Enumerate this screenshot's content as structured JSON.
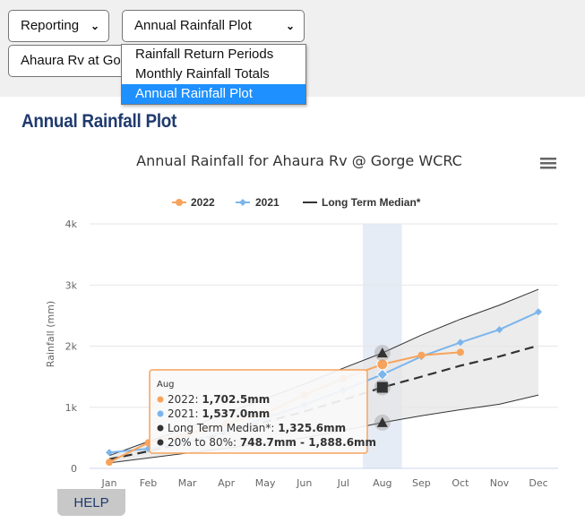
{
  "controls": {
    "report_select": {
      "value": "Reporting",
      "chevron_icon": "chevron-down-icon"
    },
    "plot_select": {
      "value": "Annual Rainfall Plot",
      "chevron_icon": "chevron-down-icon"
    },
    "site_select": {
      "value": "Ahaura Rv at Gorge"
    },
    "plot_options": [
      {
        "label": "Rainfall Return Periods",
        "selected": false
      },
      {
        "label": "Monthly Rainfall Totals",
        "selected": false
      },
      {
        "label": "Annual Rainfall Plot",
        "selected": true
      }
    ]
  },
  "page": {
    "title": "Annual Rainfall Plot",
    "help_label": "HELP",
    "menu_icon": "hamburger-menu-icon"
  },
  "colors": {
    "s2022": "#f7a35c",
    "s2021": "#7cb5ec",
    "median": "#333333",
    "band": "#e6e6e6",
    "title": "#1f3a6e",
    "highlight": "#e6ecf5"
  },
  "chart_data": {
    "type": "line",
    "title": "Annual Rainfall for Ahaura Rv @ Gorge WCRC",
    "xlabel": "",
    "ylabel": "Rainfall (mm)",
    "ylim": [
      0,
      4000
    ],
    "yticks": [
      0,
      1000,
      2000,
      3000,
      4000
    ],
    "ytick_labels": [
      "0",
      "1k",
      "2k",
      "3k",
      "4k"
    ],
    "categories": [
      "Jan",
      "Feb",
      "Mar",
      "Apr",
      "May",
      "Jun",
      "Jul",
      "Aug",
      "Sep",
      "Oct",
      "Nov",
      "Dec"
    ],
    "grid": true,
    "legend_position": "top-center",
    "series": [
      {
        "name": "2022",
        "marker": "circle",
        "values": [
          100,
          420,
          560,
          730,
          900,
          1200,
          1470,
          1702.5,
          1850,
          1900,
          null,
          null
        ]
      },
      {
        "name": "2021",
        "marker": "diamond",
        "values": [
          260,
          320,
          440,
          600,
          820,
          1040,
          1280,
          1537.0,
          1830,
          2060,
          2270,
          2560
        ]
      },
      {
        "name": "Long Term Median*",
        "dashed": true,
        "values": [
          150,
          280,
          420,
          580,
          760,
          930,
          1120,
          1325.6,
          1500,
          1680,
          1830,
          2010
        ]
      }
    ],
    "band": {
      "name": "20% to 80%",
      "low": [
        90,
        170,
        250,
        330,
        410,
        500,
        620,
        748.7,
        860,
        960,
        1050,
        1200
      ],
      "high": [
        210,
        440,
        660,
        900,
        1140,
        1380,
        1640,
        1888.6,
        2180,
        2440,
        2670,
        2930
      ]
    },
    "highlighted_category": "Aug",
    "tooltip": {
      "header": "Aug",
      "rows": [
        {
          "label": "2022",
          "value": "1,702.5mm"
        },
        {
          "label": "2021",
          "value": "1,537.0mm"
        },
        {
          "label": "Long Term Median*",
          "value": "1,325.6mm"
        },
        {
          "label": "20% to 80%",
          "value": "748.7mm - 1,888.6mm"
        }
      ]
    }
  }
}
